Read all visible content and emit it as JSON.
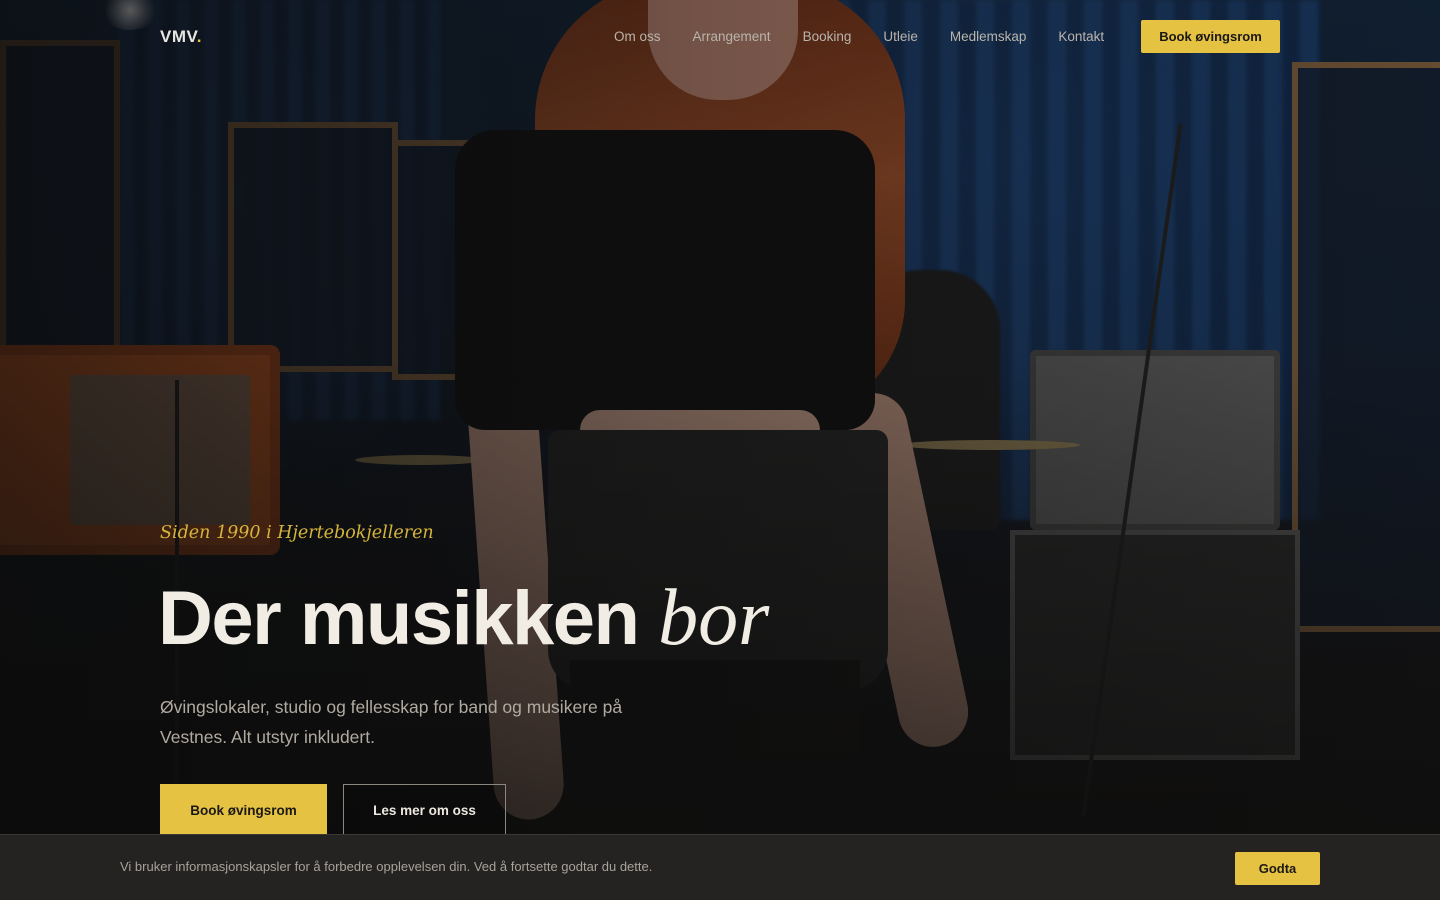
{
  "header": {
    "logo_text": "VMV",
    "logo_dot": ".",
    "nav": [
      {
        "label": "Om oss"
      },
      {
        "label": "Arrangement"
      },
      {
        "label": "Booking"
      },
      {
        "label": "Utleie"
      },
      {
        "label": "Medlemskap"
      },
      {
        "label": "Kontakt"
      }
    ],
    "cta_label": "Book øvingsrom"
  },
  "hero": {
    "eyebrow": "Siden 1990 i Hjertebokjelleren",
    "headline_main": "Der musikken",
    "headline_italic": "bor",
    "subtitle": "Øvingslokaler, studio og fellesskap for band og musikere på Vestnes. Alt utstyr inkludert.",
    "primary_button": "Book øvingsrom",
    "secondary_button": "Les mer om oss"
  },
  "cookie_banner": {
    "text": "Vi bruker informasjonskapsler for å forbedre opplevelsen din. Ved å fortsette godtar du dette.",
    "accept_label": "Godta"
  },
  "colors": {
    "accent": "#e6c242",
    "background": "#141312",
    "text_light": "#f1ede5"
  }
}
